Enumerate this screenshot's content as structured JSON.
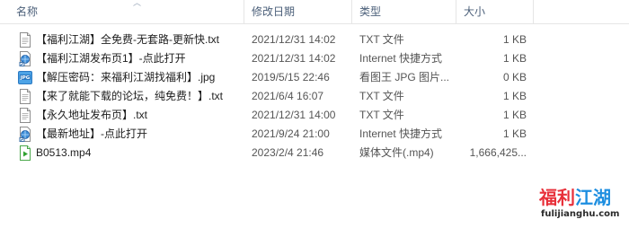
{
  "columns": {
    "name": "名称",
    "date": "修改日期",
    "type": "类型",
    "size": "大小"
  },
  "files": [
    {
      "icon": "text-file-icon",
      "name": "【福利江湖】全免费-无套路-更新快.txt",
      "date": "2021/12/31 14:02",
      "type": "TXT 文件",
      "size": "1 KB"
    },
    {
      "icon": "internet-shortcut-icon",
      "name": "【福利江湖发布页1】-点此打开",
      "date": "2021/12/31 14:02",
      "type": "Internet 快捷方式",
      "size": "1 KB"
    },
    {
      "icon": "jpg-image-icon",
      "name": "【解压密码：来福利江湖找福利】.jpg",
      "date": "2019/5/15 22:46",
      "type": "看图王 JPG 图片...",
      "size": "0 KB"
    },
    {
      "icon": "text-file-icon",
      "name": "【来了就能下载的论坛，纯免费！】.txt",
      "date": "2021/6/4 16:07",
      "type": "TXT 文件",
      "size": "1 KB"
    },
    {
      "icon": "text-file-icon",
      "name": "【永久地址发布页】.txt",
      "date": "2021/12/31 14:00",
      "type": "TXT 文件",
      "size": "1 KB"
    },
    {
      "icon": "internet-shortcut-icon",
      "name": "【最新地址】-点此打开",
      "date": "2021/9/24 21:00",
      "type": "Internet 快捷方式",
      "size": "1 KB"
    },
    {
      "icon": "media-file-icon",
      "name": "B0513.mp4",
      "date": "2023/2/4 21:46",
      "type": "媒体文件(.mp4)",
      "size": "1,666,425..."
    }
  ],
  "watermark": {
    "part1": "福利",
    "part2": "江湖",
    "domain": "fulijianghu.com"
  }
}
